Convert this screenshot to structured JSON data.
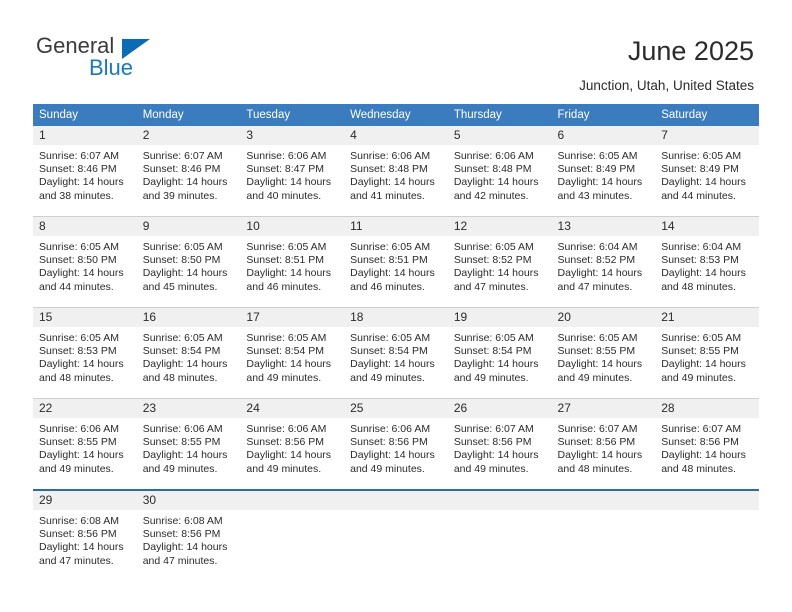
{
  "brand": {
    "name_primary": "General",
    "name_secondary": "Blue",
    "accent_color": "#1878c4",
    "triangle_color": "#0b6cb4"
  },
  "header": {
    "title": "June 2025",
    "location": "Junction, Utah, United States"
  },
  "theme": {
    "header_row_bg": "#3a7cbe",
    "header_row_text": "#ffffff",
    "daynum_bg": "#f0f0f0",
    "grid_line": "#cfcfcf",
    "last_row_border": "#2b6ca8"
  },
  "weekday_headers": [
    "Sunday",
    "Monday",
    "Tuesday",
    "Wednesday",
    "Thursday",
    "Friday",
    "Saturday"
  ],
  "weeks": [
    [
      {
        "day": "1",
        "lines": [
          "Sunrise: 6:07 AM",
          "Sunset: 8:46 PM",
          "Daylight: 14 hours",
          "and 38 minutes."
        ]
      },
      {
        "day": "2",
        "lines": [
          "Sunrise: 6:07 AM",
          "Sunset: 8:46 PM",
          "Daylight: 14 hours",
          "and 39 minutes."
        ]
      },
      {
        "day": "3",
        "lines": [
          "Sunrise: 6:06 AM",
          "Sunset: 8:47 PM",
          "Daylight: 14 hours",
          "and 40 minutes."
        ]
      },
      {
        "day": "4",
        "lines": [
          "Sunrise: 6:06 AM",
          "Sunset: 8:48 PM",
          "Daylight: 14 hours",
          "and 41 minutes."
        ]
      },
      {
        "day": "5",
        "lines": [
          "Sunrise: 6:06 AM",
          "Sunset: 8:48 PM",
          "Daylight: 14 hours",
          "and 42 minutes."
        ]
      },
      {
        "day": "6",
        "lines": [
          "Sunrise: 6:05 AM",
          "Sunset: 8:49 PM",
          "Daylight: 14 hours",
          "and 43 minutes."
        ]
      },
      {
        "day": "7",
        "lines": [
          "Sunrise: 6:05 AM",
          "Sunset: 8:49 PM",
          "Daylight: 14 hours",
          "and 44 minutes."
        ]
      }
    ],
    [
      {
        "day": "8",
        "lines": [
          "Sunrise: 6:05 AM",
          "Sunset: 8:50 PM",
          "Daylight: 14 hours",
          "and 44 minutes."
        ]
      },
      {
        "day": "9",
        "lines": [
          "Sunrise: 6:05 AM",
          "Sunset: 8:50 PM",
          "Daylight: 14 hours",
          "and 45 minutes."
        ]
      },
      {
        "day": "10",
        "lines": [
          "Sunrise: 6:05 AM",
          "Sunset: 8:51 PM",
          "Daylight: 14 hours",
          "and 46 minutes."
        ]
      },
      {
        "day": "11",
        "lines": [
          "Sunrise: 6:05 AM",
          "Sunset: 8:51 PM",
          "Daylight: 14 hours",
          "and 46 minutes."
        ]
      },
      {
        "day": "12",
        "lines": [
          "Sunrise: 6:05 AM",
          "Sunset: 8:52 PM",
          "Daylight: 14 hours",
          "and 47 minutes."
        ]
      },
      {
        "day": "13",
        "lines": [
          "Sunrise: 6:04 AM",
          "Sunset: 8:52 PM",
          "Daylight: 14 hours",
          "and 47 minutes."
        ]
      },
      {
        "day": "14",
        "lines": [
          "Sunrise: 6:04 AM",
          "Sunset: 8:53 PM",
          "Daylight: 14 hours",
          "and 48 minutes."
        ]
      }
    ],
    [
      {
        "day": "15",
        "lines": [
          "Sunrise: 6:05 AM",
          "Sunset: 8:53 PM",
          "Daylight: 14 hours",
          "and 48 minutes."
        ]
      },
      {
        "day": "16",
        "lines": [
          "Sunrise: 6:05 AM",
          "Sunset: 8:54 PM",
          "Daylight: 14 hours",
          "and 48 minutes."
        ]
      },
      {
        "day": "17",
        "lines": [
          "Sunrise: 6:05 AM",
          "Sunset: 8:54 PM",
          "Daylight: 14 hours",
          "and 49 minutes."
        ]
      },
      {
        "day": "18",
        "lines": [
          "Sunrise: 6:05 AM",
          "Sunset: 8:54 PM",
          "Daylight: 14 hours",
          "and 49 minutes."
        ]
      },
      {
        "day": "19",
        "lines": [
          "Sunrise: 6:05 AM",
          "Sunset: 8:54 PM",
          "Daylight: 14 hours",
          "and 49 minutes."
        ]
      },
      {
        "day": "20",
        "lines": [
          "Sunrise: 6:05 AM",
          "Sunset: 8:55 PM",
          "Daylight: 14 hours",
          "and 49 minutes."
        ]
      },
      {
        "day": "21",
        "lines": [
          "Sunrise: 6:05 AM",
          "Sunset: 8:55 PM",
          "Daylight: 14 hours",
          "and 49 minutes."
        ]
      }
    ],
    [
      {
        "day": "22",
        "lines": [
          "Sunrise: 6:06 AM",
          "Sunset: 8:55 PM",
          "Daylight: 14 hours",
          "and 49 minutes."
        ]
      },
      {
        "day": "23",
        "lines": [
          "Sunrise: 6:06 AM",
          "Sunset: 8:55 PM",
          "Daylight: 14 hours",
          "and 49 minutes."
        ]
      },
      {
        "day": "24",
        "lines": [
          "Sunrise: 6:06 AM",
          "Sunset: 8:56 PM",
          "Daylight: 14 hours",
          "and 49 minutes."
        ]
      },
      {
        "day": "25",
        "lines": [
          "Sunrise: 6:06 AM",
          "Sunset: 8:56 PM",
          "Daylight: 14 hours",
          "and 49 minutes."
        ]
      },
      {
        "day": "26",
        "lines": [
          "Sunrise: 6:07 AM",
          "Sunset: 8:56 PM",
          "Daylight: 14 hours",
          "and 49 minutes."
        ]
      },
      {
        "day": "27",
        "lines": [
          "Sunrise: 6:07 AM",
          "Sunset: 8:56 PM",
          "Daylight: 14 hours",
          "and 48 minutes."
        ]
      },
      {
        "day": "28",
        "lines": [
          "Sunrise: 6:07 AM",
          "Sunset: 8:56 PM",
          "Daylight: 14 hours",
          "and 48 minutes."
        ]
      }
    ],
    [
      {
        "day": "29",
        "lines": [
          "Sunrise: 6:08 AM",
          "Sunset: 8:56 PM",
          "Daylight: 14 hours",
          "and 47 minutes."
        ]
      },
      {
        "day": "30",
        "lines": [
          "Sunrise: 6:08 AM",
          "Sunset: 8:56 PM",
          "Daylight: 14 hours",
          "and 47 minutes."
        ]
      },
      {
        "day": "",
        "lines": []
      },
      {
        "day": "",
        "lines": []
      },
      {
        "day": "",
        "lines": []
      },
      {
        "day": "",
        "lines": []
      },
      {
        "day": "",
        "lines": []
      }
    ]
  ]
}
